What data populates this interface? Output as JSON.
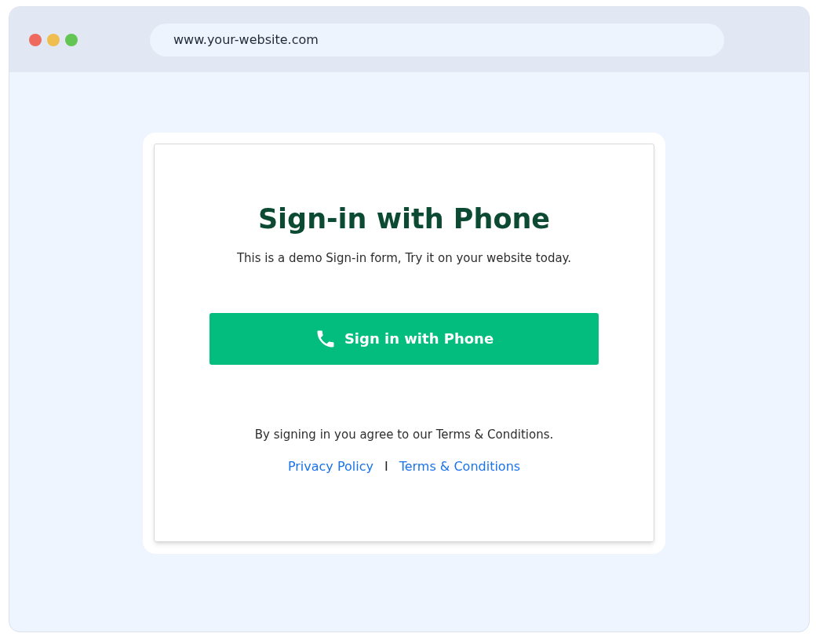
{
  "browser": {
    "window_controls": [
      {
        "color": "#ee6a5f"
      },
      {
        "color": "#f0bd4f"
      },
      {
        "color": "#62c554"
      }
    ],
    "address": "www.your-website.com"
  },
  "card": {
    "title": "Sign-in with Phone",
    "subtitle": "This is a demo Sign-in form, Try it on your website today.",
    "button": "Sign in with Phone",
    "agreement": "By signing in you agree to our Terms & Conditions.",
    "links": [
      "Privacy Policy",
      "Terms & Conditions"
    ],
    "separator": "I"
  }
}
